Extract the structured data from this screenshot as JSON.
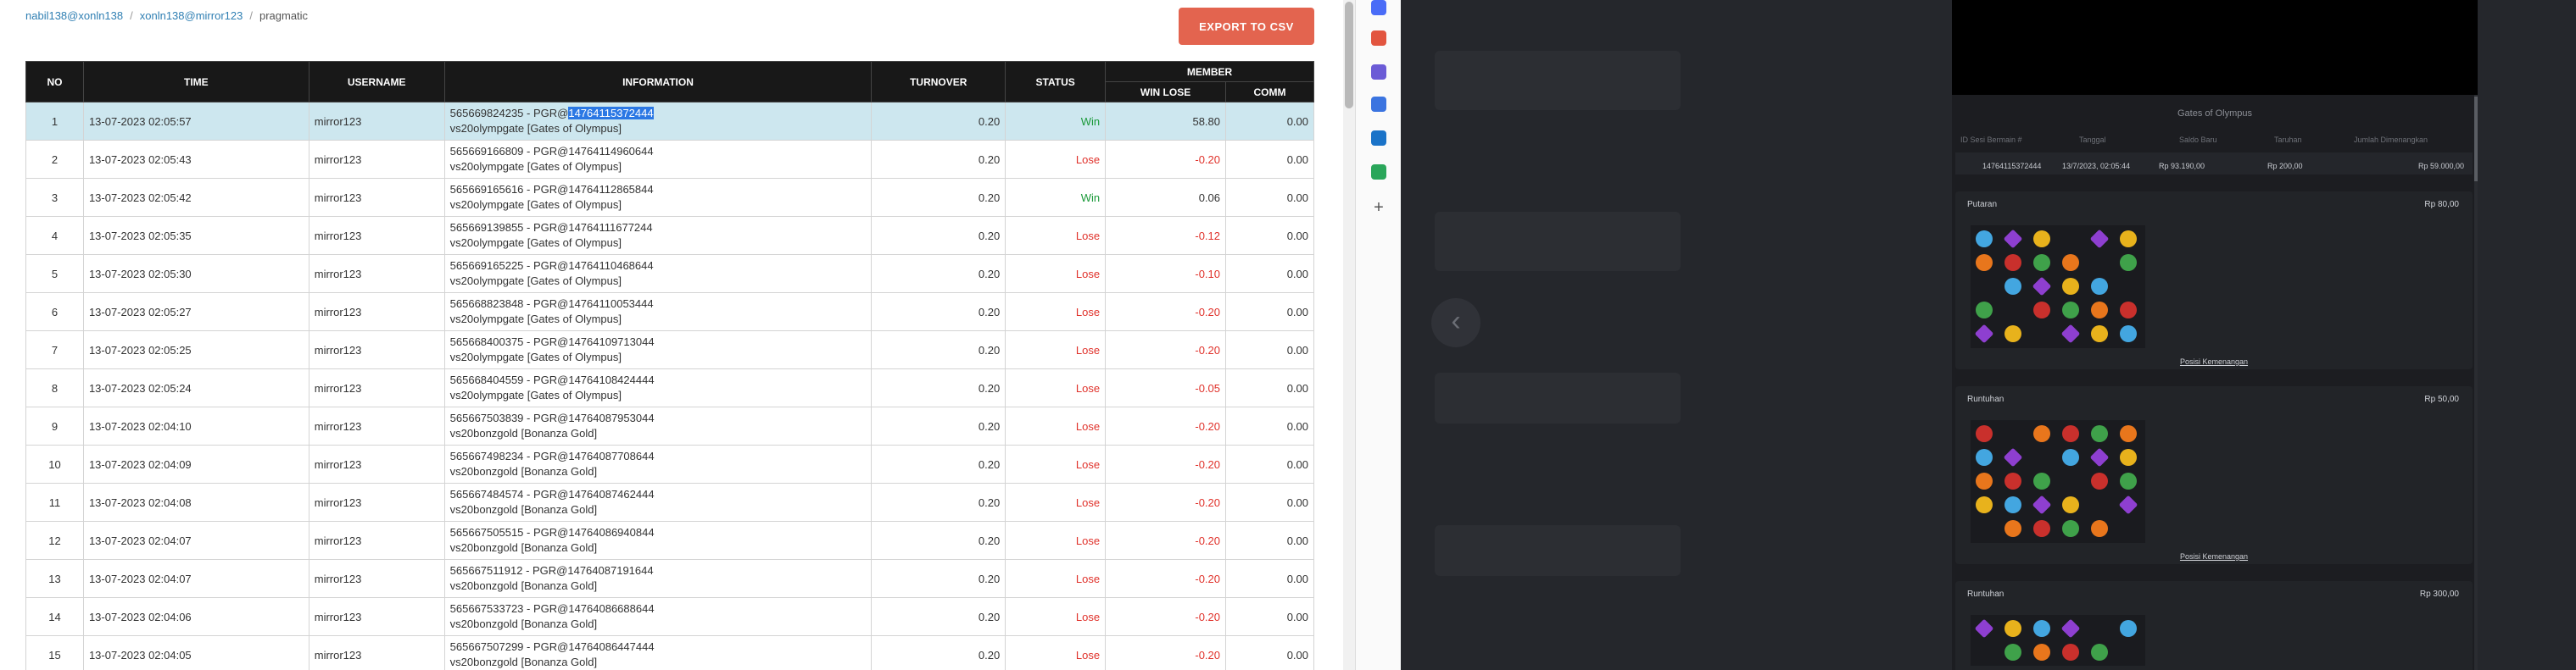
{
  "breadcrumb": {
    "items": [
      "nabil138@xonln138",
      "xonln138@mirror123",
      "pragmatic"
    ],
    "sep": "/"
  },
  "export_label": "EXPORT TO CSV",
  "table": {
    "headers": {
      "no": "NO",
      "time": "TIME",
      "username": "USERNAME",
      "information": "INFORMATION",
      "turnover": "TURNOVER",
      "status": "STATUS",
      "member": "MEMBER",
      "win_lose": "WIN LOSE",
      "comm": "COMM"
    },
    "rows": [
      {
        "no": "1",
        "time": "13-07-2023 02:05:57",
        "user": "mirror123",
        "info1_pre": "565669824235 - PGR@",
        "info1_hl": "14764115372444",
        "info2": "vs20olympgate [Gates of Olympus]",
        "turnover": "0.20",
        "status": "Win",
        "wl": "58.80",
        "comm": "0.00"
      },
      {
        "no": "2",
        "time": "13-07-2023 02:05:43",
        "user": "mirror123",
        "info1_pre": "565669166809 - PGR@14764114960644",
        "info1_hl": "",
        "info2": "vs20olympgate [Gates of Olympus]",
        "turnover": "0.20",
        "status": "Lose",
        "wl": "-0.20",
        "comm": "0.00"
      },
      {
        "no": "3",
        "time": "13-07-2023 02:05:42",
        "user": "mirror123",
        "info1_pre": "565669165616 - PGR@14764112865844",
        "info1_hl": "",
        "info2": "vs20olympgate [Gates of Olympus]",
        "turnover": "0.20",
        "status": "Win",
        "wl": "0.06",
        "comm": "0.00"
      },
      {
        "no": "4",
        "time": "13-07-2023 02:05:35",
        "user": "mirror123",
        "info1_pre": "565669139855 - PGR@14764111677244",
        "info1_hl": "",
        "info2": "vs20olympgate [Gates of Olympus]",
        "turnover": "0.20",
        "status": "Lose",
        "wl": "-0.12",
        "comm": "0.00"
      },
      {
        "no": "5",
        "time": "13-07-2023 02:05:30",
        "user": "mirror123",
        "info1_pre": "565669165225 - PGR@14764110468644",
        "info1_hl": "",
        "info2": "vs20olympgate [Gates of Olympus]",
        "turnover": "0.20",
        "status": "Lose",
        "wl": "-0.10",
        "comm": "0.00"
      },
      {
        "no": "6",
        "time": "13-07-2023 02:05:27",
        "user": "mirror123",
        "info1_pre": "565668823848 - PGR@14764110053444",
        "info1_hl": "",
        "info2": "vs20olympgate [Gates of Olympus]",
        "turnover": "0.20",
        "status": "Lose",
        "wl": "-0.20",
        "comm": "0.00"
      },
      {
        "no": "7",
        "time": "13-07-2023 02:05:25",
        "user": "mirror123",
        "info1_pre": "565668400375 - PGR@14764109713044",
        "info1_hl": "",
        "info2": "vs20olympgate [Gates of Olympus]",
        "turnover": "0.20",
        "status": "Lose",
        "wl": "-0.20",
        "comm": "0.00"
      },
      {
        "no": "8",
        "time": "13-07-2023 02:05:24",
        "user": "mirror123",
        "info1_pre": "565668404559 - PGR@14764108424444",
        "info1_hl": "",
        "info2": "vs20olympgate [Gates of Olympus]",
        "turnover": "0.20",
        "status": "Lose",
        "wl": "-0.05",
        "comm": "0.00"
      },
      {
        "no": "9",
        "time": "13-07-2023 02:04:10",
        "user": "mirror123",
        "info1_pre": "565667503839 - PGR@14764087953044",
        "info1_hl": "",
        "info2": "vs20bonzgold [Bonanza Gold]",
        "turnover": "0.20",
        "status": "Lose",
        "wl": "-0.20",
        "comm": "0.00"
      },
      {
        "no": "10",
        "time": "13-07-2023 02:04:09",
        "user": "mirror123",
        "info1_pre": "565667498234 - PGR@14764087708644",
        "info1_hl": "",
        "info2": "vs20bonzgold [Bonanza Gold]",
        "turnover": "0.20",
        "status": "Lose",
        "wl": "-0.20",
        "comm": "0.00"
      },
      {
        "no": "11",
        "time": "13-07-2023 02:04:08",
        "user": "mirror123",
        "info1_pre": "565667484574 - PGR@14764087462444",
        "info1_hl": "",
        "info2": "vs20bonzgold [Bonanza Gold]",
        "turnover": "0.20",
        "status": "Lose",
        "wl": "-0.20",
        "comm": "0.00"
      },
      {
        "no": "12",
        "time": "13-07-2023 02:04:07",
        "user": "mirror123",
        "info1_pre": "565667505515 - PGR@14764086940844",
        "info1_hl": "",
        "info2": "vs20bonzgold [Bonanza Gold]",
        "turnover": "0.20",
        "status": "Lose",
        "wl": "-0.20",
        "comm": "0.00"
      },
      {
        "no": "13",
        "time": "13-07-2023 02:04:07",
        "user": "mirror123",
        "info1_pre": "565667511912 - PGR@14764087191644",
        "info1_hl": "",
        "info2": "vs20bonzgold [Bonanza Gold]",
        "turnover": "0.20",
        "status": "Lose",
        "wl": "-0.20",
        "comm": "0.00"
      },
      {
        "no": "14",
        "time": "13-07-2023 02:04:06",
        "user": "mirror123",
        "info1_pre": "565667533723 - PGR@14764086688644",
        "info1_hl": "",
        "info2": "vs20bonzgold [Bonanza Gold]",
        "turnover": "0.20",
        "status": "Lose",
        "wl": "-0.20",
        "comm": "0.00"
      },
      {
        "no": "15",
        "time": "13-07-2023 02:04:05",
        "user": "mirror123",
        "info1_pre": "565667507299 - PGR@14764086447444",
        "info1_hl": "",
        "info2": "vs20bonzgold [Bonanza Gold]",
        "turnover": "0.20",
        "status": "Lose",
        "wl": "-0.20",
        "comm": "0.00"
      }
    ]
  },
  "sidebar_icons": [
    {
      "name": "diamond-icon",
      "color": "#4a6cf7"
    },
    {
      "name": "toolbox-icon",
      "color": "#e2553f"
    },
    {
      "name": "chess-icon",
      "color": "#6b5bd6"
    },
    {
      "name": "shield-icon",
      "color": "#3b74e0"
    },
    {
      "name": "outlook-icon",
      "color": "#1a73c8"
    },
    {
      "name": "cart-icon",
      "color": "#2aa65a"
    },
    {
      "name": "plus-icon",
      "color": "#555555"
    }
  ],
  "game": {
    "title": "Gates of Olympus",
    "summary_headers": [
      "ID Sesi Bermain #",
      "Tanggal",
      "Saldo Baru",
      "Taruhan",
      "Jumlah Dimenangkan"
    ],
    "summary_values": [
      "14764115372444",
      "13/7/2023, 02:05:44",
      "Rp 93.190,00",
      "Rp 200,00",
      "Rp 59.000,00"
    ],
    "rounds": [
      {
        "label": "Putaran",
        "amount": "Rp 80,00",
        "link": "Posisi Kemenangan"
      },
      {
        "label": "Runtuhan",
        "amount": "Rp 50,00",
        "link": "Posisi Kemenangan"
      },
      {
        "label": "Runtuhan",
        "amount": "Rp 300,00",
        "link": ""
      }
    ]
  }
}
